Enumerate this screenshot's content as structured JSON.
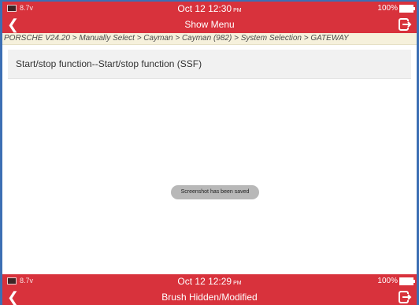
{
  "top_screen": {
    "status": {
      "left": "8.7v",
      "time": "Oct 12  12:30",
      "ampm": "PM",
      "battery": "100%"
    },
    "title": "Show Menu",
    "breadcrumb": "PORSCHE V24.20 > Manually Select > Cayman > Cayman (982) > System Selection > GATEWAY",
    "menu_items": [
      "Start/stop function--Start/stop function (SSF)"
    ],
    "toast": "Screenshot has been saved"
  },
  "bottom_screen": {
    "status": {
      "left": "8.7v",
      "time": "Oct 12  12:29",
      "ampm": "PM",
      "battery": "100%"
    },
    "title": "Brush Hidden/Modified"
  },
  "colors": {
    "header": "#d8323c",
    "breadcrumb_bg": "#f6f1dc",
    "frame": "#3c6fb4"
  }
}
